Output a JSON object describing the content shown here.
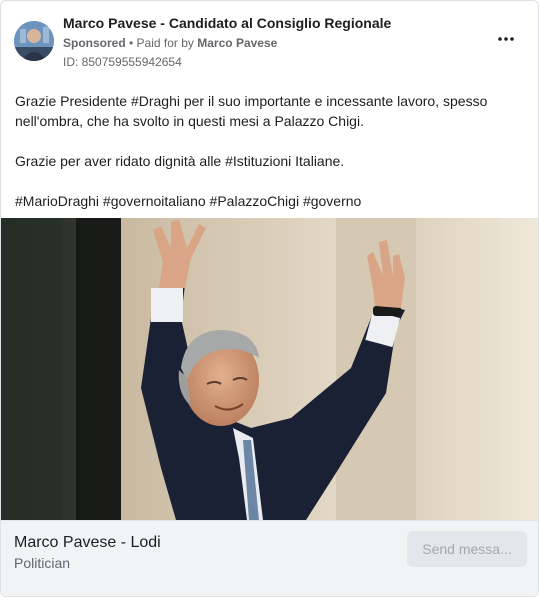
{
  "post": {
    "page_name": "Marco Pavese - Candidato al Consiglio Regionale",
    "sponsored_label": "Sponsored",
    "separator": " • ",
    "paid_for_label": "Paid for by",
    "advertiser": "Marco Pavese",
    "ad_id": "ID: 850759555942654",
    "more_icon": "more-horizontal-icon",
    "paragraphs": [
      "Grazie Presidente #Draghi per il suo importante e incessante lavoro, spesso\nnell'ombra, che ha svolto in questi mesi a Palazzo Chigi.",
      "Grazie per aver ridato dignità alle #Istituzioni Italiane.",
      "#MarioDraghi #governoitaliano #PalazzoChigi #governo"
    ]
  },
  "footer": {
    "title": "Marco Pavese - Lodi",
    "subtitle": "Politician",
    "button_label": "Send messa..."
  },
  "colors": {
    "text": "#1c1e21",
    "secondary_text": "#65676b",
    "footer_bg": "#f2f3f5",
    "button_bg": "#e4e6eb",
    "button_text": "#a6a8ac"
  }
}
